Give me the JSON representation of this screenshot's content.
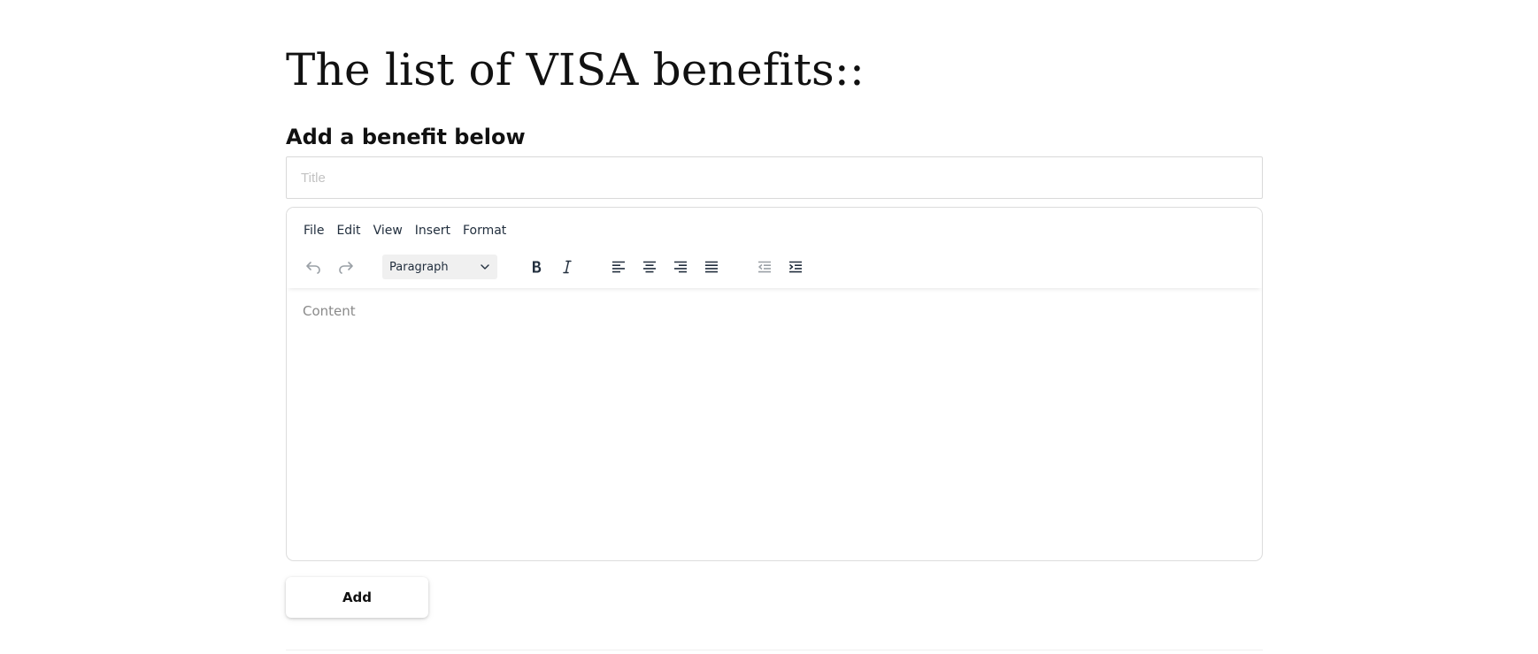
{
  "page": {
    "title": "The list of VISA benefits::",
    "section_heading": "Add a benefit below"
  },
  "form": {
    "title_placeholder": "Title",
    "title_value": "",
    "content_placeholder": "Content",
    "add_label": "Add"
  },
  "editor": {
    "menu": [
      "File",
      "Edit",
      "View",
      "Insert",
      "Format"
    ],
    "block_format": "Paragraph",
    "toolbar_icons": [
      "undo-icon",
      "redo-icon",
      "bold-icon",
      "italic-icon",
      "align-left-icon",
      "align-center-icon",
      "align-right-icon",
      "align-justify-icon",
      "outdent-icon",
      "indent-icon"
    ]
  },
  "colors": {
    "text": "#111111",
    "toolbar_icon": "#222f3e",
    "toolbar_icon_disabled": "#9aa0a6",
    "border": "#d9d9d9",
    "placeholder": "#c2c2c2"
  }
}
